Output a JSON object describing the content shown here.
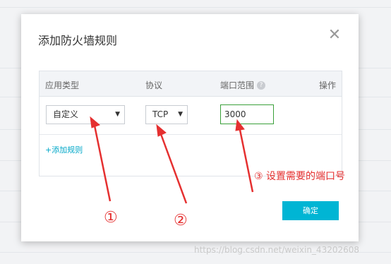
{
  "dialog": {
    "title": "添加防火墙规则",
    "close_glyph": "✕"
  },
  "table": {
    "headers": {
      "type": "应用类型",
      "protocol": "协议",
      "port_range": "端口范围",
      "help_glyph": "?",
      "operation": "操作"
    },
    "row": {
      "type_value": "自定义",
      "protocol_value": "TCP",
      "port_value": "3000"
    },
    "add_rule_label": "+添加规则"
  },
  "confirm_label": "确定",
  "annotations": {
    "marker1": "①",
    "marker2": "②",
    "marker3": "③  设置需要的端口号",
    "color": "#e53030"
  },
  "watermark": "https://blog.csdn.net/weixin_43202608",
  "colors": {
    "accent": "#00b5d4",
    "link": "#00a7c8",
    "port_border": "#3aa03a"
  }
}
